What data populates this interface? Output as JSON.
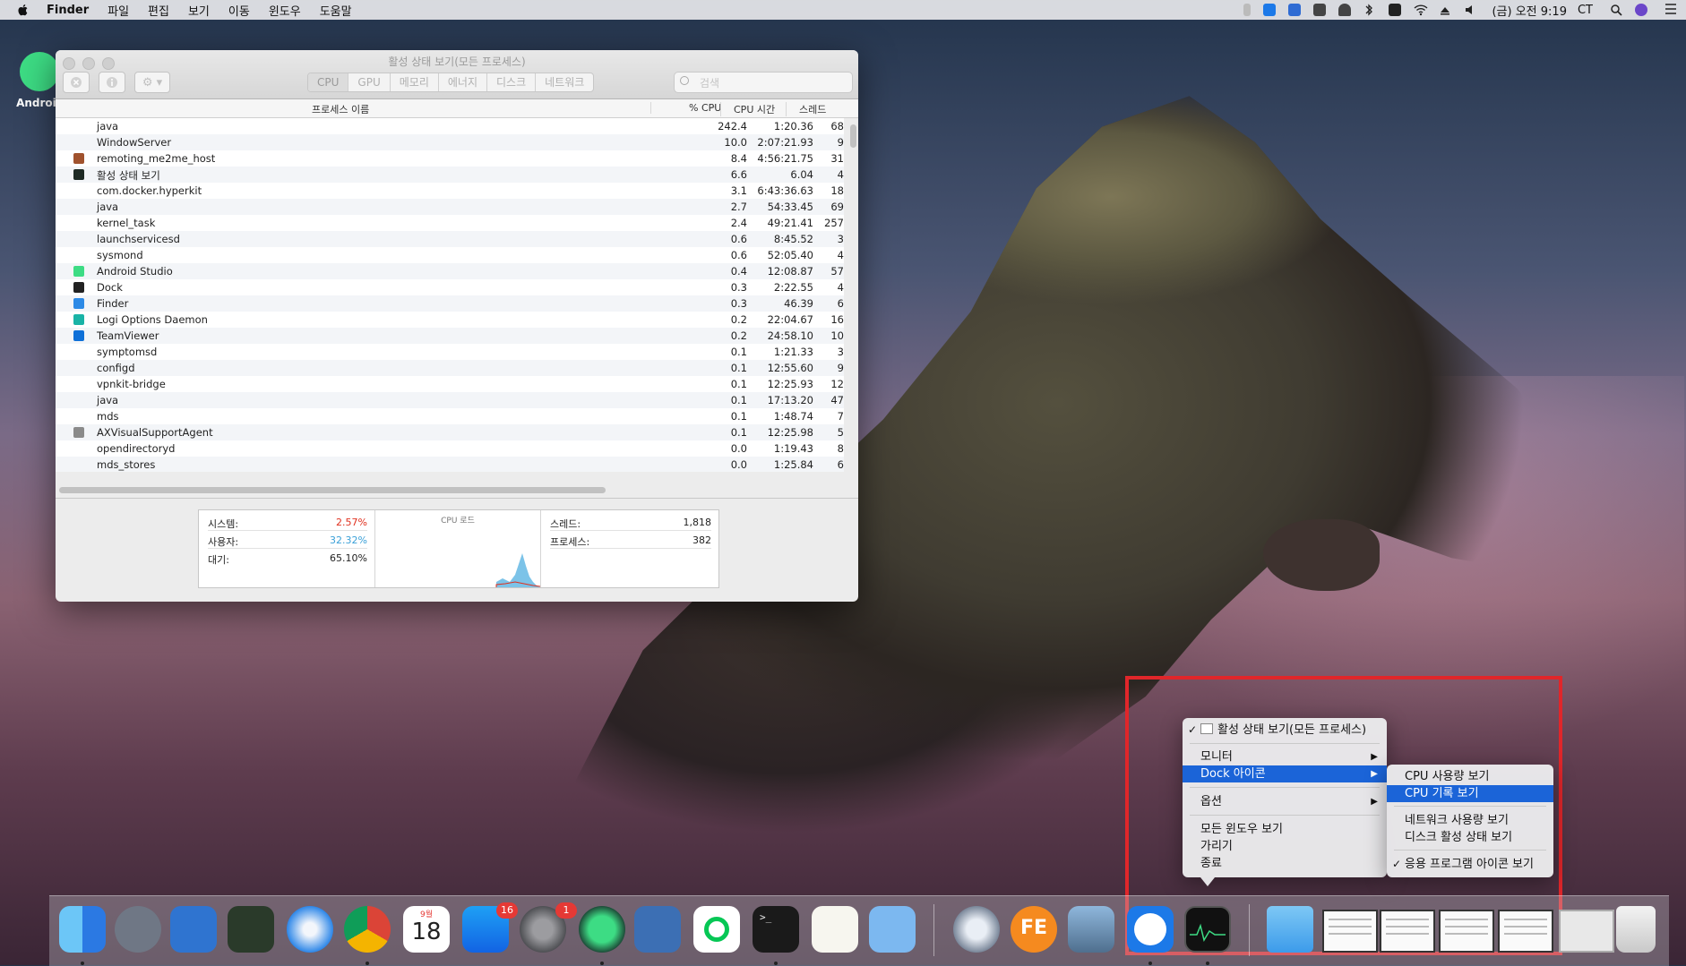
{
  "menubar": {
    "app": "Finder",
    "items": [
      "파일",
      "편집",
      "보기",
      "이동",
      "윈도우",
      "도움말"
    ],
    "clock": "(금) 오전 9:19",
    "user": "CT",
    "status_icons": [
      "battery-icon",
      "teamviewer-icon",
      "remote-icon",
      "docker-icon",
      "ghost-icon",
      "bluetooth-icon",
      "korean-input-icon",
      "wifi-icon",
      "airplay-icon",
      "volume-icon"
    ]
  },
  "desktop": {
    "icon_label": "Androic"
  },
  "window": {
    "title": "활성 상태 보기(모든 프로세스)",
    "tabs": [
      "CPU",
      "GPU",
      "메모리",
      "에너지",
      "디스크",
      "네트워크"
    ],
    "active_tab": "CPU",
    "search_placeholder": "검색",
    "columns": {
      "name": "프로세스 이름",
      "cpu": "% CPU",
      "time": "CPU 시간",
      "threads": "스레드"
    },
    "rows": [
      {
        "name": "java",
        "cpu": "242.4",
        "time": "1:20.36",
        "threads": "68",
        "icon": ""
      },
      {
        "name": "WindowServer",
        "cpu": "10.0",
        "time": "2:07:21.93",
        "threads": "9",
        "icon": ""
      },
      {
        "name": "remoting_me2me_host",
        "cpu": "8.4",
        "time": "4:56:21.75",
        "threads": "31",
        "icon": "#a0522d"
      },
      {
        "name": "활성 상태 보기",
        "cpu": "6.6",
        "time": "6.04",
        "threads": "4",
        "icon": "#1e2a24"
      },
      {
        "name": "com.docker.hyperkit",
        "cpu": "3.1",
        "time": "6:43:36.63",
        "threads": "18",
        "icon": ""
      },
      {
        "name": "java",
        "cpu": "2.7",
        "time": "54:33.45",
        "threads": "69",
        "icon": ""
      },
      {
        "name": "kernel_task",
        "cpu": "2.4",
        "time": "49:21.41",
        "threads": "257",
        "icon": ""
      },
      {
        "name": "launchservicesd",
        "cpu": "0.6",
        "time": "8:45.52",
        "threads": "3",
        "icon": ""
      },
      {
        "name": "sysmond",
        "cpu": "0.6",
        "time": "52:05.40",
        "threads": "4",
        "icon": ""
      },
      {
        "name": "Android Studio",
        "cpu": "0.4",
        "time": "12:08.87",
        "threads": "57",
        "icon": "#3ddc84"
      },
      {
        "name": "Dock",
        "cpu": "0.3",
        "time": "2:22.55",
        "threads": "4",
        "icon": "#222222"
      },
      {
        "name": "Finder",
        "cpu": "0.3",
        "time": "46.39",
        "threads": "6",
        "icon": "#2d8ae6"
      },
      {
        "name": "Logi Options Daemon",
        "cpu": "0.2",
        "time": "22:04.67",
        "threads": "16",
        "icon": "#19b3a6"
      },
      {
        "name": "TeamViewer",
        "cpu": "0.2",
        "time": "24:58.10",
        "threads": "10",
        "icon": "#0e70d8"
      },
      {
        "name": "symptomsd",
        "cpu": "0.1",
        "time": "1:21.33",
        "threads": "3",
        "icon": ""
      },
      {
        "name": "configd",
        "cpu": "0.1",
        "time": "12:55.60",
        "threads": "9",
        "icon": ""
      },
      {
        "name": "vpnkit-bridge",
        "cpu": "0.1",
        "time": "12:25.93",
        "threads": "12",
        "icon": ""
      },
      {
        "name": "java",
        "cpu": "0.1",
        "time": "17:13.20",
        "threads": "47",
        "icon": ""
      },
      {
        "name": "mds",
        "cpu": "0.1",
        "time": "1:48.74",
        "threads": "7",
        "icon": ""
      },
      {
        "name": "AXVisualSupportAgent",
        "cpu": "0.1",
        "time": "12:25.98",
        "threads": "5",
        "icon": "#8a8a8a"
      },
      {
        "name": "opendirectoryd",
        "cpu": "0.0",
        "time": "1:19.43",
        "threads": "8",
        "icon": ""
      },
      {
        "name": "mds_stores",
        "cpu": "0.0",
        "time": "1:25.84",
        "threads": "6",
        "icon": ""
      }
    ],
    "stats": {
      "system_label": "시스템:",
      "system_value": "2.57%",
      "user_label": "사용자:",
      "user_value": "32.32%",
      "idle_label": "대기:",
      "idle_value": "65.10%",
      "cpu_load_title": "CPU 로드",
      "threads_label": "스레드:",
      "threads_value": "1,818",
      "processes_label": "프로세스:",
      "processes_value": "382"
    },
    "colors": {
      "system": "#e0301e",
      "user": "#3aa0d8"
    }
  },
  "context_menu": {
    "header": "활성 상태 보기(모든 프로세스)",
    "items": [
      "모니터",
      "Dock 아이콘",
      "옵션",
      "모든 윈도우 보기",
      "가리기",
      "종료"
    ],
    "selected": "Dock 아이콘"
  },
  "submenu": {
    "items": [
      "CPU 사용량 보기",
      "CPU 기록 보기",
      "네트워크 사용량 보기",
      "디스크 활성 상태 보기",
      "응용 프로그램 아이콘 보기"
    ],
    "selected": "CPU 기록 보기",
    "checked": "응용 프로그램 아이콘 보기"
  },
  "dock": {
    "calendar_month": "9월",
    "calendar_day": "18",
    "appstore_badge": "16",
    "prefs_badge": "1",
    "terminal_prompt": ">_",
    "fe_label": "FE",
    "apps": [
      "finder",
      "launchpad",
      "mission-control",
      "image-capture",
      "safari",
      "chrome",
      "calendar",
      "app-store",
      "system-preferences",
      "android-studio",
      "virtualbox",
      "line",
      "terminal",
      "textedit",
      "xcode-helper",
      "camo",
      "fe-file-explorer",
      "preview",
      "teamviewer",
      "activity-monitor"
    ]
  }
}
